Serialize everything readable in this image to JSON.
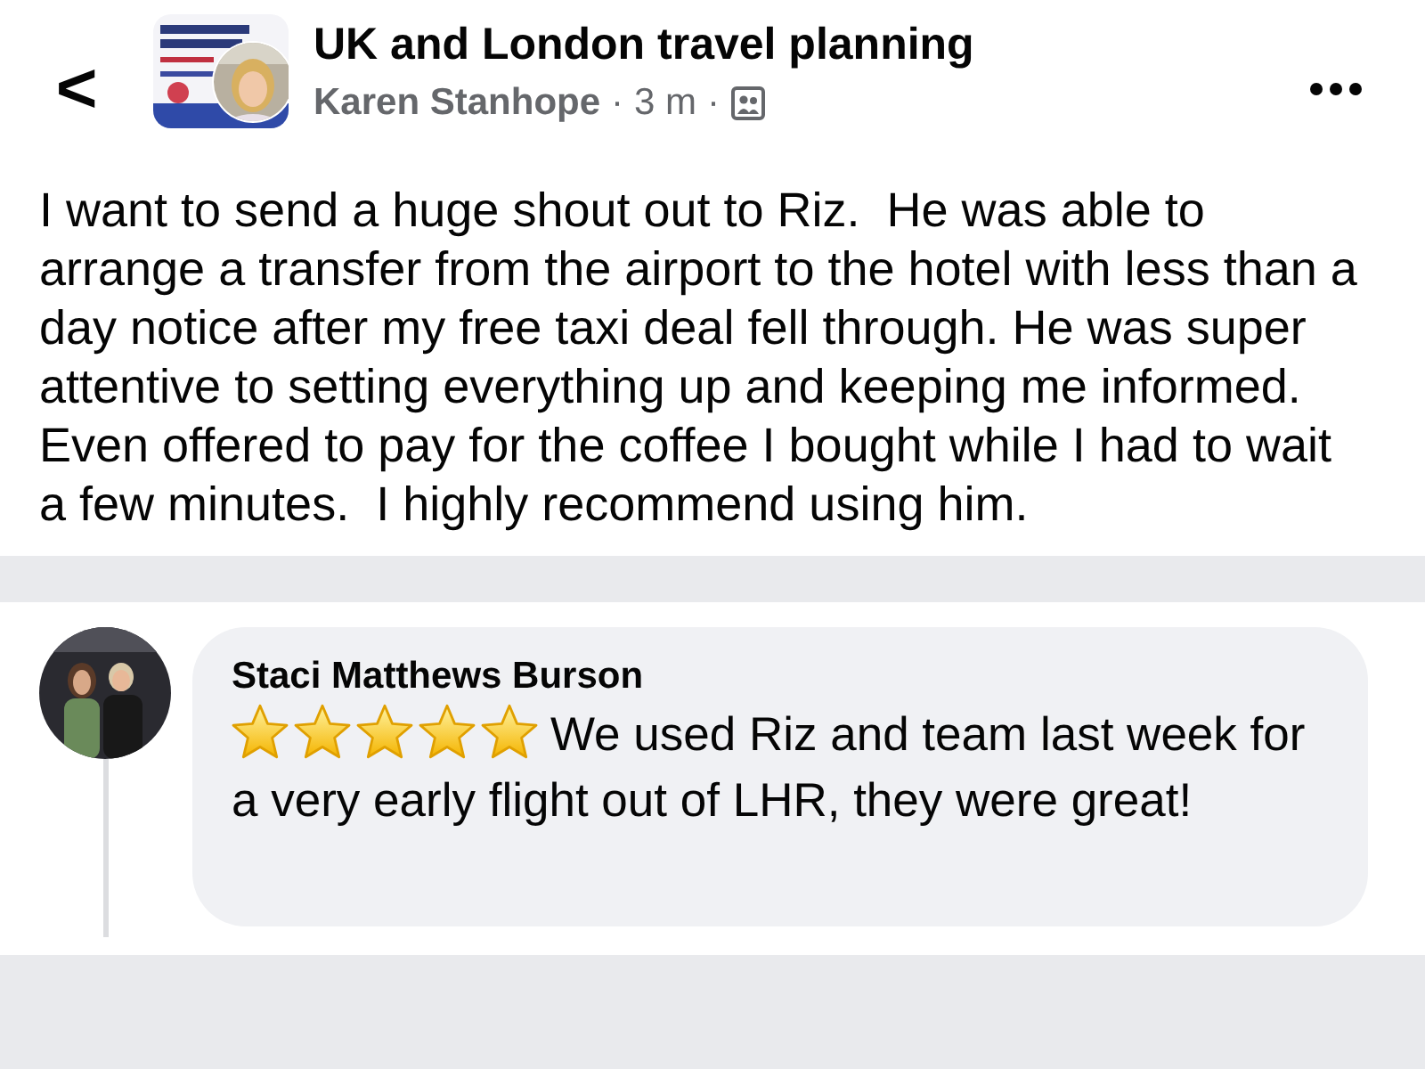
{
  "header": {
    "back": "<",
    "group_name": "UK and London travel planning",
    "author": "Karen Stanhope",
    "separator_1": "·",
    "time": "3 m",
    "separator_2": "·"
  },
  "post": {
    "text": "I want to send a huge shout out to Riz.  He was able to arrange a transfer from the airport to the hotel with less than a day notice after my free taxi deal fell through. He was super attentive to setting everything up and keeping me informed. Even offered to pay for the coffee I bought while I had to wait a few minutes.  I highly recommend using him."
  },
  "comment": {
    "author": "Staci Matthews Burson",
    "stars": 5,
    "text": "We used Riz and team last week for a very early flight out of LHR, they were great!"
  }
}
